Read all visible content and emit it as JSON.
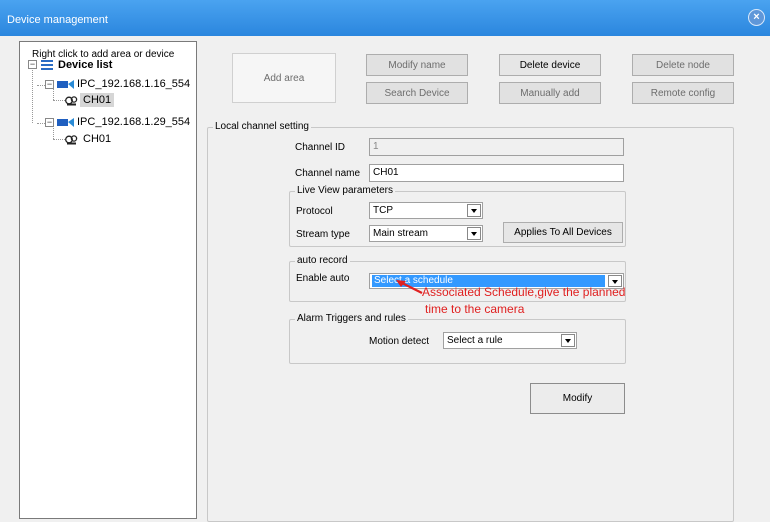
{
  "window": {
    "title": "Device management",
    "close_glyph": "×"
  },
  "tree": {
    "hint": "Right click to add area or device",
    "root": "Device list",
    "devices": [
      {
        "name": "IPC_192.168.1.16_554",
        "channel": "CH01",
        "selected": true
      },
      {
        "name": "IPC_192.168.1.29_554",
        "channel": "CH01",
        "selected": false
      }
    ]
  },
  "toolbar": {
    "add_area": "Add area",
    "modify_name": "Modify name",
    "delete_device": "Delete device",
    "delete_node": "Delete node",
    "search_device": "Search Device",
    "manually_add": "Manually add",
    "remote_config": "Remote config"
  },
  "local_channel": {
    "legend": "Local channel setting",
    "channel_id_label": "Channel ID",
    "channel_id_value": "1",
    "channel_name_label": "Channel name",
    "channel_name_value": "CH01"
  },
  "live_view": {
    "legend": "Live View parameters",
    "protocol_label": "Protocol",
    "protocol_value": "TCP",
    "stream_type_label": "Stream type",
    "stream_type_value": "Main stream",
    "apply_all": "Applies To All Devices"
  },
  "auto_record": {
    "legend": "auto record",
    "enable_label": "Enable auto",
    "schedule_value": "Select a schedule"
  },
  "annotation": {
    "line1": "Associated Schedule,give the planned",
    "line2": "time to the camera",
    "color": "#e02020"
  },
  "alarm": {
    "legend": "Alarm Triggers and rules",
    "motion_label": "Motion detect",
    "rule_value": "Select a rule"
  },
  "actions": {
    "modify": "Modify"
  }
}
